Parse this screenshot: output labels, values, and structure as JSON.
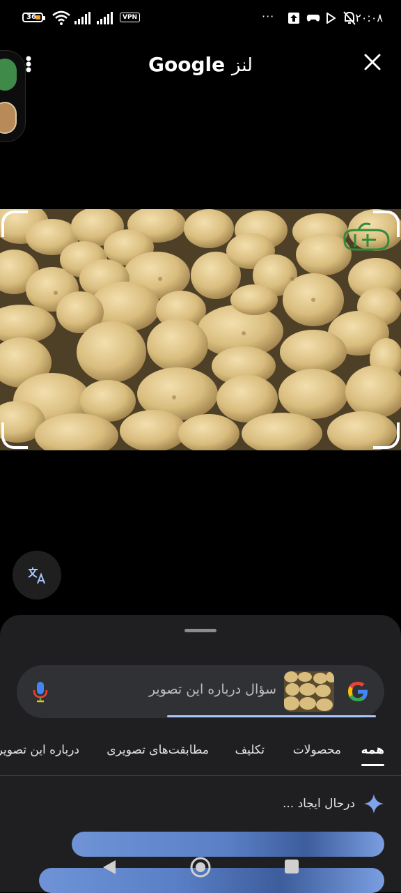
{
  "status_bar": {
    "battery_level": "36",
    "vpn_label": "VPN",
    "more_dots": "···",
    "time": "۲۰:۰۸",
    "icons": [
      "wifi-icon",
      "signal-icon",
      "signal-icon",
      "upload-icon",
      "gamepad-icon",
      "play-icon",
      "alarm-off-icon"
    ]
  },
  "header": {
    "title_brand": "Google",
    "title_word": "لنز",
    "menu_icon": "more-vert-icon",
    "close_icon": "close-icon"
  },
  "image": {
    "subject": "potatoes",
    "crop_frame_color": "#ffffff",
    "watermark_color": "#2f8c3a"
  },
  "translate_button": {
    "icon": "translate-icon"
  },
  "sheet": {
    "search": {
      "placeholder": "سؤال درباره این تصویر",
      "mic_icon": "mic-icon",
      "logo": "google-g-logo"
    },
    "tabs": [
      {
        "label": "همه",
        "active": true
      },
      {
        "label": "محصولات",
        "active": false
      },
      {
        "label": "تکلیف",
        "active": false
      },
      {
        "label": "مطابقت‌های تصویری",
        "active": false
      },
      {
        "label": "درباره این تصویر",
        "active": false
      }
    ],
    "generating_label": "درحال ایجاد ...",
    "sparkle_icon": "sparkle-icon"
  },
  "colors": {
    "sheet_bg": "#1f1f21",
    "searchbar_bg": "#303134",
    "accent": "#a8c7fa",
    "shimmer": "#6f93d6"
  }
}
